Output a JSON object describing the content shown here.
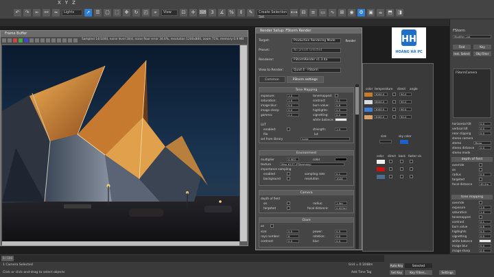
{
  "app": {
    "menu": [
      "X",
      "Y",
      "Z"
    ],
    "view_dropdown": "Lights",
    "selection_set": "Create Selection Set"
  },
  "vfb": {
    "title": "Frame Buffer",
    "status": "Sampled 14/1000, noise level 18/4, noise floor error 34.6%, resolution 1200x800, zoom 71%, memory 0.9 MB"
  },
  "render_setup": {
    "title": "Render Setup: FStorm Render",
    "target_label": "Target:",
    "target_value": "Production Rendering Mode",
    "preset_label": "Preset:",
    "preset_value": "No preset selected",
    "renderer_label": "Renderer:",
    "renderer_value": "FStormRender v1.3.4a",
    "view_label": "View to Render:",
    "view_value": "Quad 4 - FStorm",
    "render_button": "Render",
    "tabs": [
      "Common",
      "FStorm settings"
    ],
    "tone_mapping": {
      "header": "Tone Mapping",
      "left": [
        {
          "label": "exposure:",
          "value": "1.0"
        },
        {
          "label": "saturation:",
          "value": "1.0"
        },
        {
          "label": "image blur:",
          "value": "0.0"
        },
        {
          "label": "image sharp:",
          "value": "0.0"
        },
        {
          "label": "gamma:",
          "value": "2.2"
        }
      ],
      "right": [
        {
          "label": "tonemapped:",
          "value": ""
        },
        {
          "label": "contrast:",
          "value": "0.1"
        },
        {
          "label": "burn value:",
          "value": "0.8"
        },
        {
          "label": "highlights:",
          "value": "0.5"
        },
        {
          "label": "vignetting:",
          "value": "0.0"
        },
        {
          "label": "white balance:",
          "value": ""
        }
      ],
      "lut_header": "LUT",
      "lut_enabled": "enabled:",
      "lut_strength": "strength:",
      "lut_strength_value": "1.0",
      "lut_file": "file",
      "lut_file_value": "lut",
      "lut_library": "set from library",
      "lut_none": "none"
    },
    "environment": {
      "header": "Environment",
      "multiplier": "multiplier",
      "multiplier_value": "0.903",
      "color": "color",
      "texture": "texture",
      "texture_value": "Map #127 (FStormsky)",
      "importance": "importance sampling",
      "enabled": "enabled",
      "sampling_rate": "sampling rate:",
      "sampling_rate_value": "0.1",
      "background": "background",
      "resolution": "resolution",
      "resolution_value": "1024"
    },
    "camera": {
      "header": "Camera",
      "dof": "depth of field",
      "on": "on",
      "radius": "radius:",
      "radius_value": "1.0m",
      "targeted": "targeted",
      "focal": "focal distance:",
      "focal_value": "0.025m"
    },
    "glare": {
      "header": "Glare",
      "on": "on",
      "size": "size:",
      "size_value": "0.5",
      "power": "power:",
      "power_value": "0.5",
      "blade": "rays number:",
      "blade_value": "6",
      "rotation": "rotation:",
      "rotation_value": "0.0",
      "contrast": "contrast:",
      "contrast_value": "0.5",
      "blur": "blur:",
      "blur_value": "0.0"
    }
  },
  "material_panel": {
    "headers": [
      "color",
      "temperature",
      "direct",
      "angle"
    ],
    "rows": [
      {
        "color": "#c87c2a",
        "temp": "3000.0",
        "angle": "90.0"
      },
      {
        "color": "#d8dde4",
        "temp": "6500.0",
        "angle": "90.0"
      },
      {
        "color": "#3f7fd9",
        "temp": "3000.0",
        "angle": "90.0"
      },
      {
        "color": "#d8a36a",
        "temp": "3000.0",
        "angle": "90.0"
      }
    ],
    "sky_label": "sky color",
    "size_label": "size",
    "col_labels": [
      "color",
      "direct",
      "back",
      "faster vis"
    ],
    "swatches": [
      "#f0f0f0",
      "#cc1111",
      "#4a6e8f"
    ]
  },
  "command_panel": {
    "title": "FStorm",
    "modifier_list": "Modifier List",
    "buttons": [
      "Find",
      "Key",
      "Inst. Select",
      "Obj Filter"
    ],
    "object_name": "FStormCamera",
    "params": [
      {
        "label": "horizontal tilt",
        "value": "0.0"
      },
      {
        "label": "vertical tilt",
        "value": "0.0"
      },
      {
        "label": "near clipping",
        "value": "0.0"
      },
      {
        "label": "stereo camera",
        "value": ""
      }
    ],
    "stereo": "stereo",
    "stereo_value": "Mono",
    "stereo_distance": "stereo distance",
    "stereo_dist_value": "0.0",
    "stereo_mode": "stereo mode",
    "dof_header": "depth of field",
    "dof": [
      {
        "label": "override",
        "value": ""
      },
      {
        "label": "on",
        "value": ""
      },
      {
        "label": "radius",
        "value": "0.0"
      },
      {
        "label": "targeted",
        "value": ""
      },
      {
        "label": "focal distance",
        "value": "45.2m"
      }
    ],
    "tm_header": "tone mapping",
    "tm": [
      {
        "label": "override",
        "value": ""
      },
      {
        "label": "exposure",
        "value": "1.0"
      },
      {
        "label": "saturation",
        "value": "1.0"
      },
      {
        "label": "tonemapped",
        "value": ""
      },
      {
        "label": "contrast",
        "value": "0.1"
      },
      {
        "label": "burn value",
        "value": "0.8"
      },
      {
        "label": "highlights",
        "value": "0.5"
      },
      {
        "label": "vignetting",
        "value": "0.0"
      },
      {
        "label": "white balance",
        "value": ""
      },
      {
        "label": "image blur",
        "value": "0.0"
      },
      {
        "label": "image sharp",
        "value": "0.0"
      }
    ]
  },
  "logo": {
    "text": "HOÀNG HÀ PC"
  },
  "bottom": {
    "status1": "1 Camera Selected",
    "status2": "Click or click-and-drag to select objects",
    "grid": "Grid = 0.1048m",
    "add_time_tag": "Add Time Tag",
    "auto_key": "Auto Key",
    "selected": "Selected",
    "set_key": "Set Key",
    "key_filters": "Key Filters...",
    "settings": "Settings",
    "frame": "0 / 100"
  }
}
